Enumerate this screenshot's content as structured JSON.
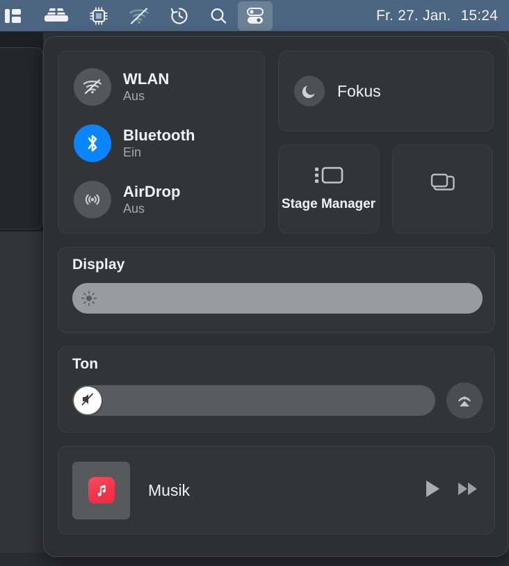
{
  "menubar": {
    "icons": [
      {
        "name": "sidebar-layout-icon"
      },
      {
        "name": "disk-stack-icon"
      },
      {
        "name": "cpu-chip-icon"
      },
      {
        "name": "wifi-off-icon"
      },
      {
        "name": "time-machine-icon"
      },
      {
        "name": "search-icon"
      },
      {
        "name": "control-center-icon"
      }
    ],
    "date": "Fr. 27. Jan.",
    "time": "15:24"
  },
  "control_center": {
    "toggles": [
      {
        "label": "WLAN",
        "status": "Aus",
        "active": false,
        "icon": "wifi-off-icon"
      },
      {
        "label": "Bluetooth",
        "status": "Ein",
        "active": true,
        "icon": "bluetooth-icon"
      },
      {
        "label": "AirDrop",
        "status": "Aus",
        "active": false,
        "icon": "airdrop-icon"
      }
    ],
    "focus": {
      "label": "Fokus",
      "icon": "moon-icon"
    },
    "tiles": [
      {
        "label": "Stage Manager",
        "icon": "stage-manager-icon"
      },
      {
        "label": "",
        "icon": "screen-mirroring-icon"
      }
    ],
    "display": {
      "title": "Display",
      "value": 100,
      "icon": "brightness-sun-icon"
    },
    "sound": {
      "title": "Ton",
      "value": 0,
      "icon": "speaker-mute-icon",
      "airplay_icon": "airplay-audio-icon"
    },
    "music": {
      "title": "Musik",
      "app_icon": "apple-music-icon",
      "play_label": "play-icon",
      "next_label": "fast-forward-icon"
    }
  },
  "colors": {
    "menubar": "#4c6580",
    "panel": "#2e2f31",
    "module": "#333436",
    "accent_on": "#0a84ff",
    "music_red": "#f5344a",
    "slider_track": "#555658",
    "slider_fill": "#9a9b9d"
  }
}
